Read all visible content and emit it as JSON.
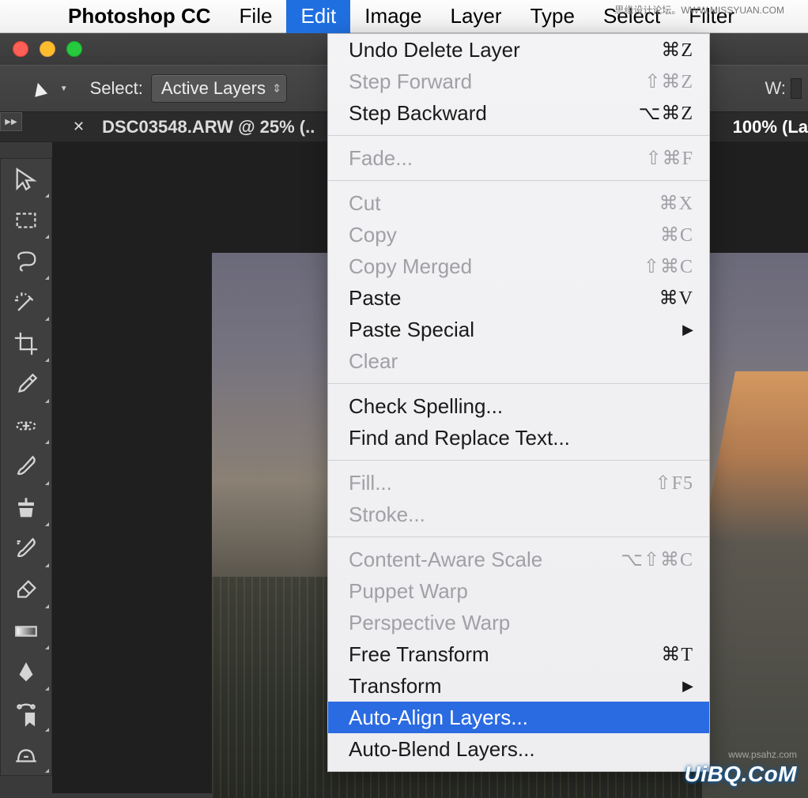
{
  "menubar": {
    "app": "Photoshop CC",
    "items": [
      "File",
      "Edit",
      "Image",
      "Layer",
      "Type",
      "Select",
      "Filter"
    ],
    "open_index": 1
  },
  "watermark_top": "思缘设计论坛。WWW.MISSYUAN.COM",
  "watermark_bottom": "UiBQ.CoM",
  "watermark_bottom2": "www.psahz.com",
  "options_bar": {
    "select_label": "Select:",
    "select_value": "Active Layers",
    "w_label": "W:"
  },
  "tabs": {
    "tab1": "DSC03548.ARW @ 25% (..",
    "tab2": "100% (La"
  },
  "tools": [
    "move",
    "marquee",
    "lasso",
    "wand",
    "crop",
    "eyedropper",
    "healing",
    "brush",
    "stamp",
    "history-brush",
    "eraser",
    "gradient",
    "pen",
    "path-sel",
    "shape"
  ],
  "edit_menu": {
    "groups": [
      [
        {
          "label": "Undo Delete Layer",
          "shortcut": "⌘Z",
          "enabled": true
        },
        {
          "label": "Step Forward",
          "shortcut": "⇧⌘Z",
          "enabled": false
        },
        {
          "label": "Step Backward",
          "shortcut": "⌥⌘Z",
          "enabled": true
        }
      ],
      [
        {
          "label": "Fade...",
          "shortcut": "⇧⌘F",
          "enabled": false
        }
      ],
      [
        {
          "label": "Cut",
          "shortcut": "⌘X",
          "enabled": false
        },
        {
          "label": "Copy",
          "shortcut": "⌘C",
          "enabled": false
        },
        {
          "label": "Copy Merged",
          "shortcut": "⇧⌘C",
          "enabled": false
        },
        {
          "label": "Paste",
          "shortcut": "⌘V",
          "enabled": true
        },
        {
          "label": "Paste Special",
          "shortcut": "",
          "enabled": true,
          "submenu": true
        },
        {
          "label": "Clear",
          "shortcut": "",
          "enabled": false
        }
      ],
      [
        {
          "label": "Check Spelling...",
          "shortcut": "",
          "enabled": true
        },
        {
          "label": "Find and Replace Text...",
          "shortcut": "",
          "enabled": true
        }
      ],
      [
        {
          "label": "Fill...",
          "shortcut": "⇧F5",
          "enabled": false
        },
        {
          "label": "Stroke...",
          "shortcut": "",
          "enabled": false
        }
      ],
      [
        {
          "label": "Content-Aware Scale",
          "shortcut": "⌥⇧⌘C",
          "enabled": false
        },
        {
          "label": "Puppet Warp",
          "shortcut": "",
          "enabled": false
        },
        {
          "label": "Perspective Warp",
          "shortcut": "",
          "enabled": false
        },
        {
          "label": "Free Transform",
          "shortcut": "⌘T",
          "enabled": true
        },
        {
          "label": "Transform",
          "shortcut": "",
          "enabled": true,
          "submenu": true
        },
        {
          "label": "Auto-Align Layers...",
          "shortcut": "",
          "enabled": true,
          "highlight": true
        },
        {
          "label": "Auto-Blend Layers...",
          "shortcut": "",
          "enabled": true
        }
      ]
    ]
  }
}
